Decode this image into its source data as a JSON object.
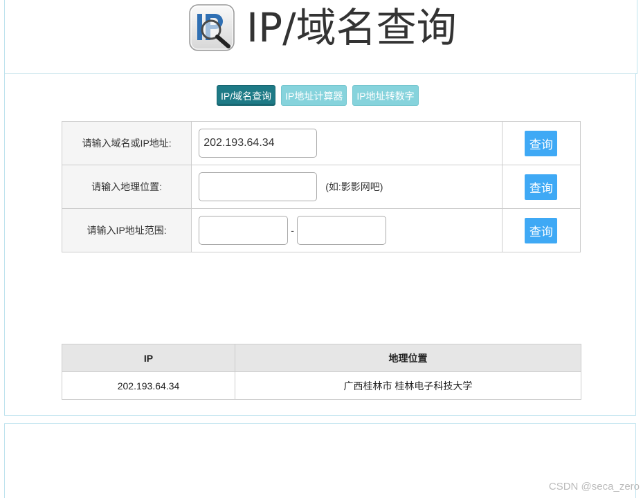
{
  "header": {
    "title": "IP/域名查询",
    "logo_icon": "ip-magnifier-logo-icon"
  },
  "tabs": [
    {
      "label": "IP/域名查询",
      "active": true
    },
    {
      "label": "IP地址计算器",
      "active": false
    },
    {
      "label": "IP地址转数字",
      "active": false
    }
  ],
  "query_form": {
    "domain_row": {
      "label": "请输入域名或IP地址:",
      "value": "202.193.64.34",
      "button": "查询"
    },
    "location_row": {
      "label": "请输入地理位置:",
      "value": "",
      "hint": "(如:影影网吧)",
      "button": "查询"
    },
    "range_row": {
      "label": "请输入IP地址范围:",
      "start_value": "",
      "separator": "-",
      "end_value": "",
      "button": "查询"
    }
  },
  "results": {
    "columns": [
      "IP",
      "地理位置"
    ],
    "rows": [
      {
        "ip": "202.193.64.34",
        "location": "广西桂林市 桂林电子科技大学"
      }
    ]
  },
  "watermark": "CSDN @seca_zero",
  "colors": {
    "tab_active": "#1e7a86",
    "tab_inactive": "#86d3dc",
    "query_button": "#3fa9f5",
    "panel_border": "#bfe3ee"
  }
}
